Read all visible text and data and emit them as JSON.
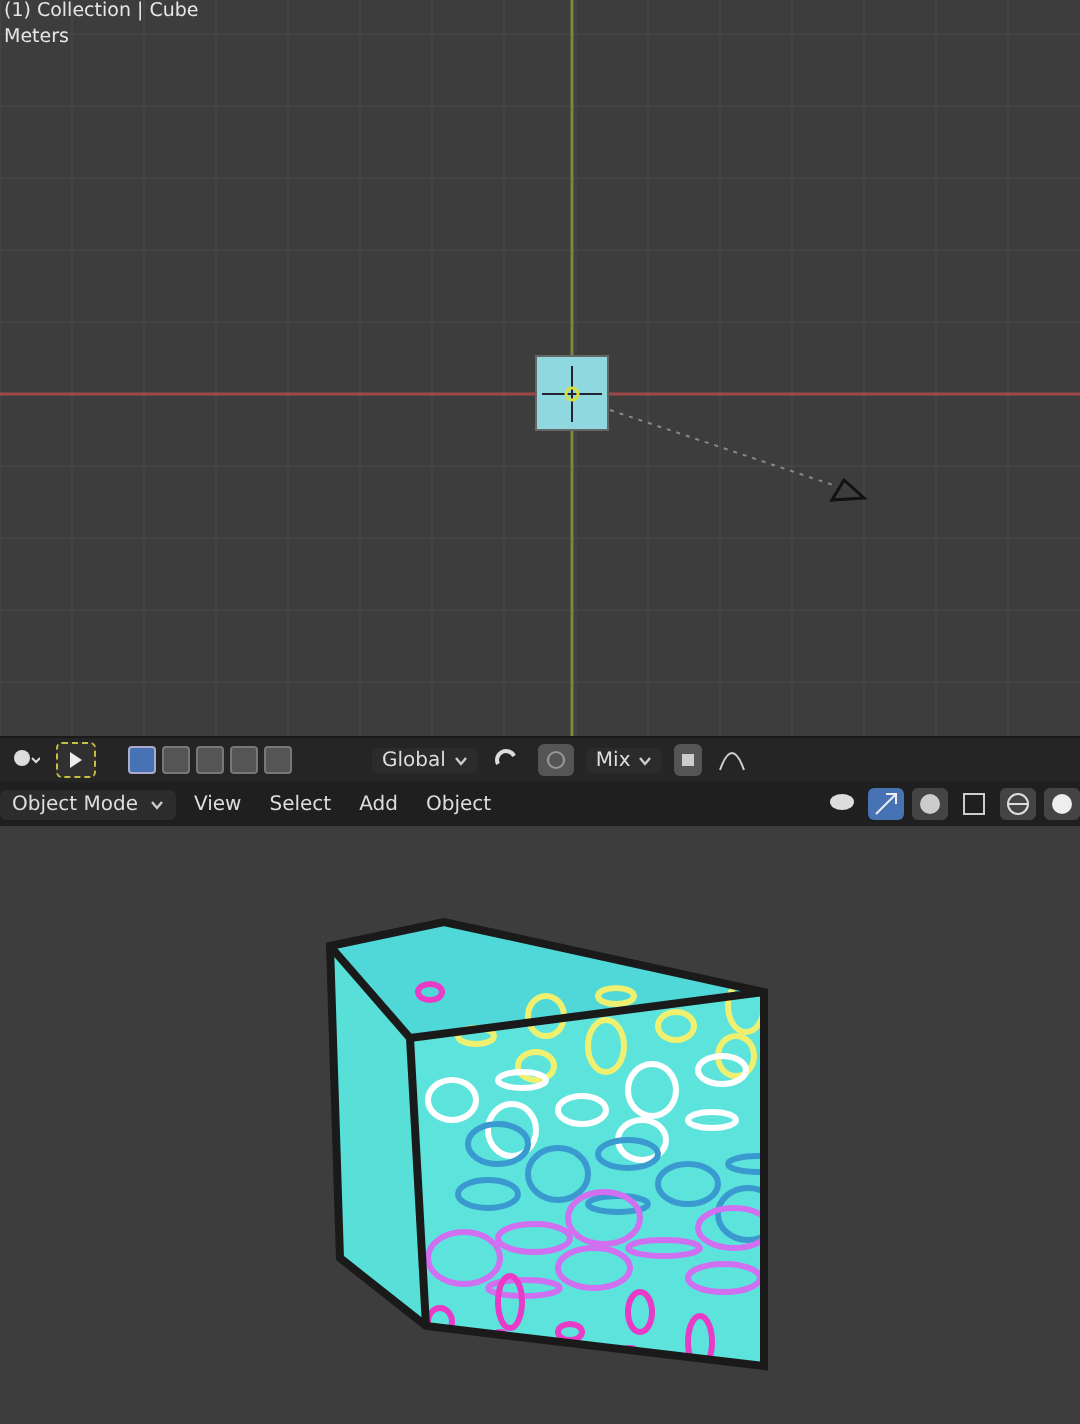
{
  "top_viewport": {
    "overlay": [
      "(1) Collection | Cube",
      "Meters"
    ]
  },
  "tool_header": {
    "select_modes": [
      {
        "selected": true
      },
      {
        "selected": false
      },
      {
        "selected": false
      },
      {
        "selected": false
      },
      {
        "selected": false
      }
    ],
    "orientation": "Global",
    "blend": "Mix"
  },
  "viewport_header": {
    "mode": "Object Mode",
    "menus": [
      "View",
      "Select",
      "Add",
      "Object"
    ]
  }
}
